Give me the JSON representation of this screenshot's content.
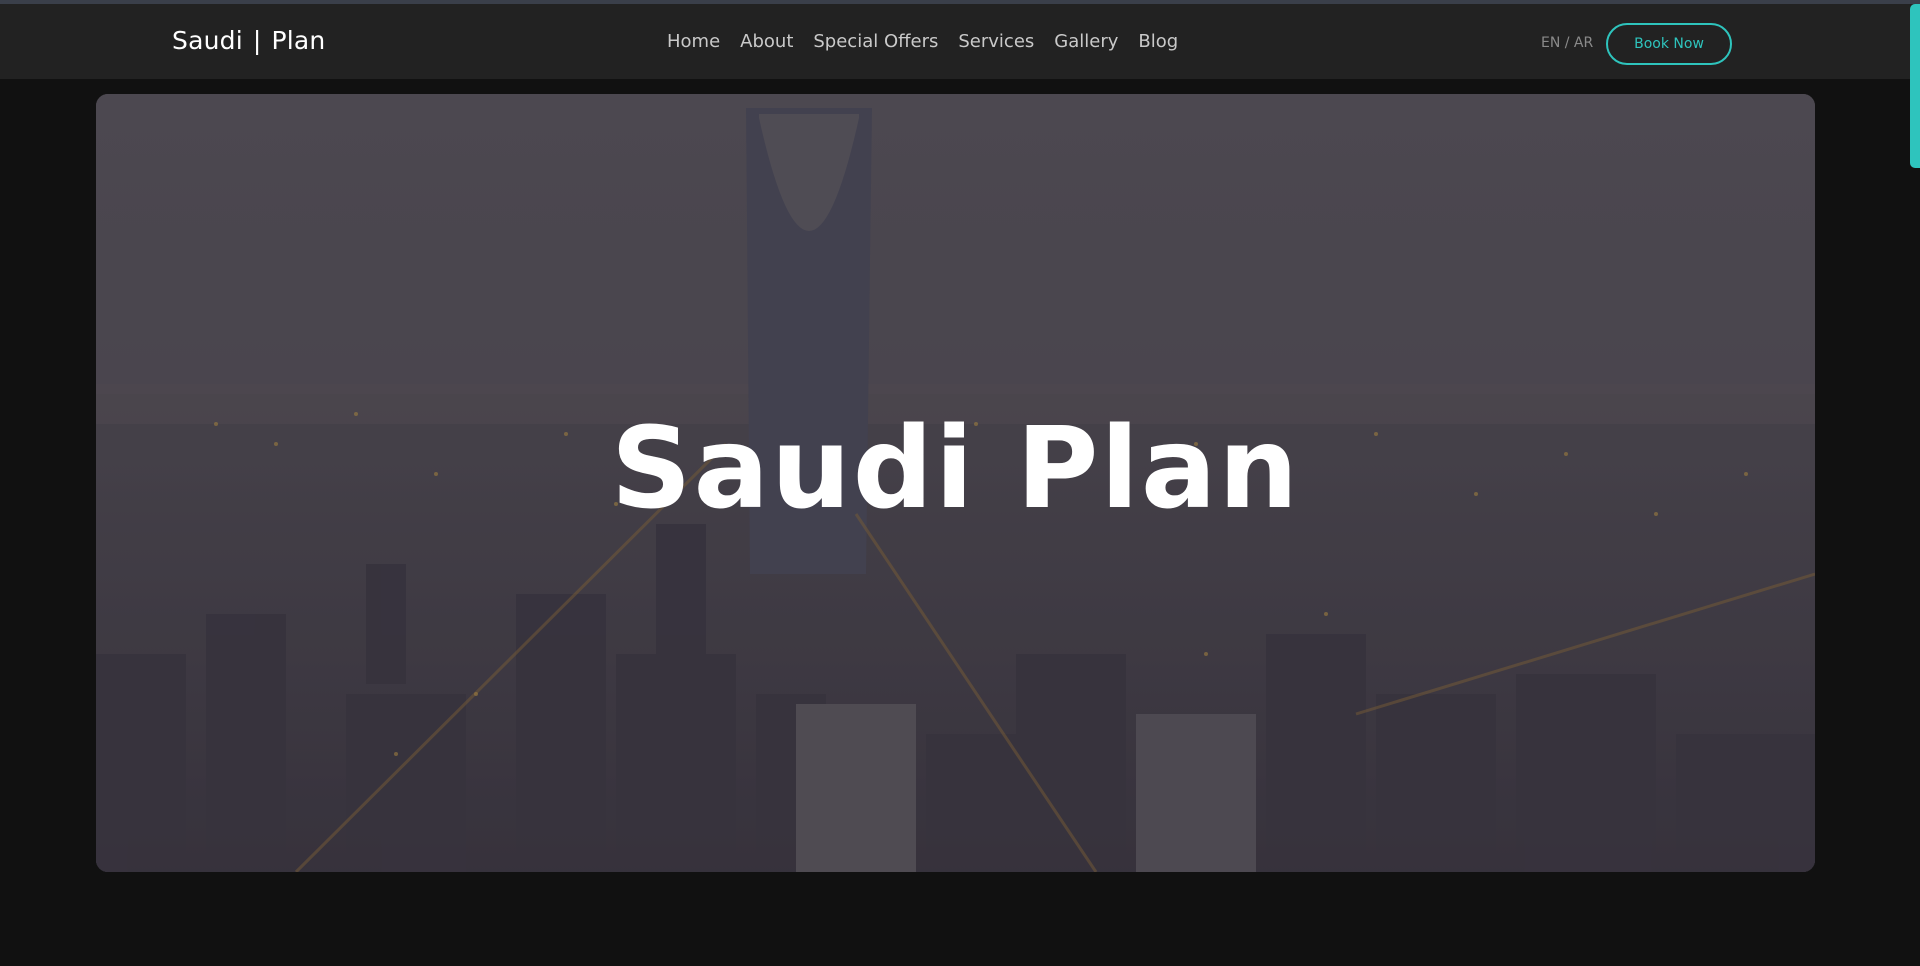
{
  "brand": {
    "left": "Saudi",
    "separator": "|",
    "right": "Plan"
  },
  "nav": {
    "items": [
      {
        "label": "Home"
      },
      {
        "label": "About"
      },
      {
        "label": "Special Offers"
      },
      {
        "label": "Services"
      },
      {
        "label": "Gallery"
      },
      {
        "label": "Blog"
      }
    ],
    "language_switch": "EN / AR",
    "book_label": "Book Now"
  },
  "hero": {
    "title": "Saudi Plan",
    "image_icon": "riyadh-skyline-image"
  },
  "colors": {
    "accent": "#2ec4bd",
    "navbar_bg": "#222222",
    "page_bg": "#111111"
  }
}
